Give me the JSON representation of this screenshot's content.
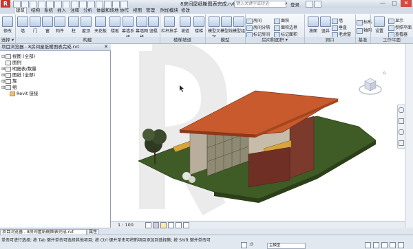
{
  "app": {
    "logo": "R",
    "title": "8房间屋纸榭图表完成.rvt - 三维视图: {三...",
    "search_placeholder": "键入关键字或短语",
    "login_label": "登录",
    "window_controls": [
      "—",
      "□",
      "✕"
    ]
  },
  "ribbon": {
    "tabs": [
      "建筑",
      "结构",
      "系统",
      "插入",
      "注释",
      "分析",
      "体量和场地",
      "协作",
      "视图",
      "管理",
      "附加模块",
      "修改"
    ],
    "active_tab": "建筑",
    "buttons": [
      {
        "label": "修改"
      },
      {
        "label": "墙"
      },
      {
        "label": "门"
      },
      {
        "label": "窗"
      },
      {
        "label": "构件"
      },
      {
        "label": "柱"
      },
      {
        "label": "屋顶"
      },
      {
        "label": "天花板"
      },
      {
        "label": "楼板"
      },
      {
        "label": "幕墙系统"
      },
      {
        "label": "幕墙网格"
      },
      {
        "label": "竖梃"
      },
      {
        "label": "栏杆扶手"
      },
      {
        "label": "坡道"
      },
      {
        "label": "楼梯"
      },
      {
        "label": "模型文字"
      },
      {
        "label": "模型线"
      },
      {
        "label": "模型组"
      },
      {
        "label": "房间"
      },
      {
        "label": "房间分隔"
      },
      {
        "label": "标记房间"
      },
      {
        "label": "面积"
      },
      {
        "label": "面积边界"
      },
      {
        "label": "标记面积"
      },
      {
        "label": "按面"
      },
      {
        "label": "竖井"
      },
      {
        "label": "墙"
      },
      {
        "label": "垂直"
      },
      {
        "label": "老虎窗"
      },
      {
        "label": "标高"
      },
      {
        "label": "轴网"
      },
      {
        "label": "设置"
      },
      {
        "label": "显示"
      },
      {
        "label": "参照平面"
      },
      {
        "label": "查看器"
      }
    ],
    "panels": [
      "选择 ▾",
      "构建",
      "楼梯坡道",
      "模型",
      "房间和面积 ▾",
      "洞口",
      "基准",
      "工作平面"
    ]
  },
  "browser": {
    "title": "项目浏览器 - 8房间屋纸榭图表完成.rvt",
    "close": "✕",
    "items": [
      {
        "expander": "⊟",
        "label": "视图 (全部)"
      },
      {
        "expander": "",
        "label": "图例"
      },
      {
        "expander": "⊞",
        "label": "明细表/数量"
      },
      {
        "expander": "⊞",
        "label": "图纸 (全部)"
      },
      {
        "expander": "⊞",
        "label": "族"
      },
      {
        "expander": "⊞",
        "label": "组"
      },
      {
        "expander": "",
        "label": "Revit 链接"
      }
    ],
    "tabs": [
      "项目浏览器 - 8房间屋纸榭图表完成.rvt",
      "属性"
    ]
  },
  "view": {
    "scale": "1 : 100",
    "cube_label": "前"
  },
  "statusbar": {
    "text": "单击可进行选择; 按 Tab 键并单击可选择其他项目; 按 Ctrl 键并单击可将新项目添加到选择集; 按 Shift 键并单击可",
    "model_label": "主模型",
    "count": ":0"
  }
}
